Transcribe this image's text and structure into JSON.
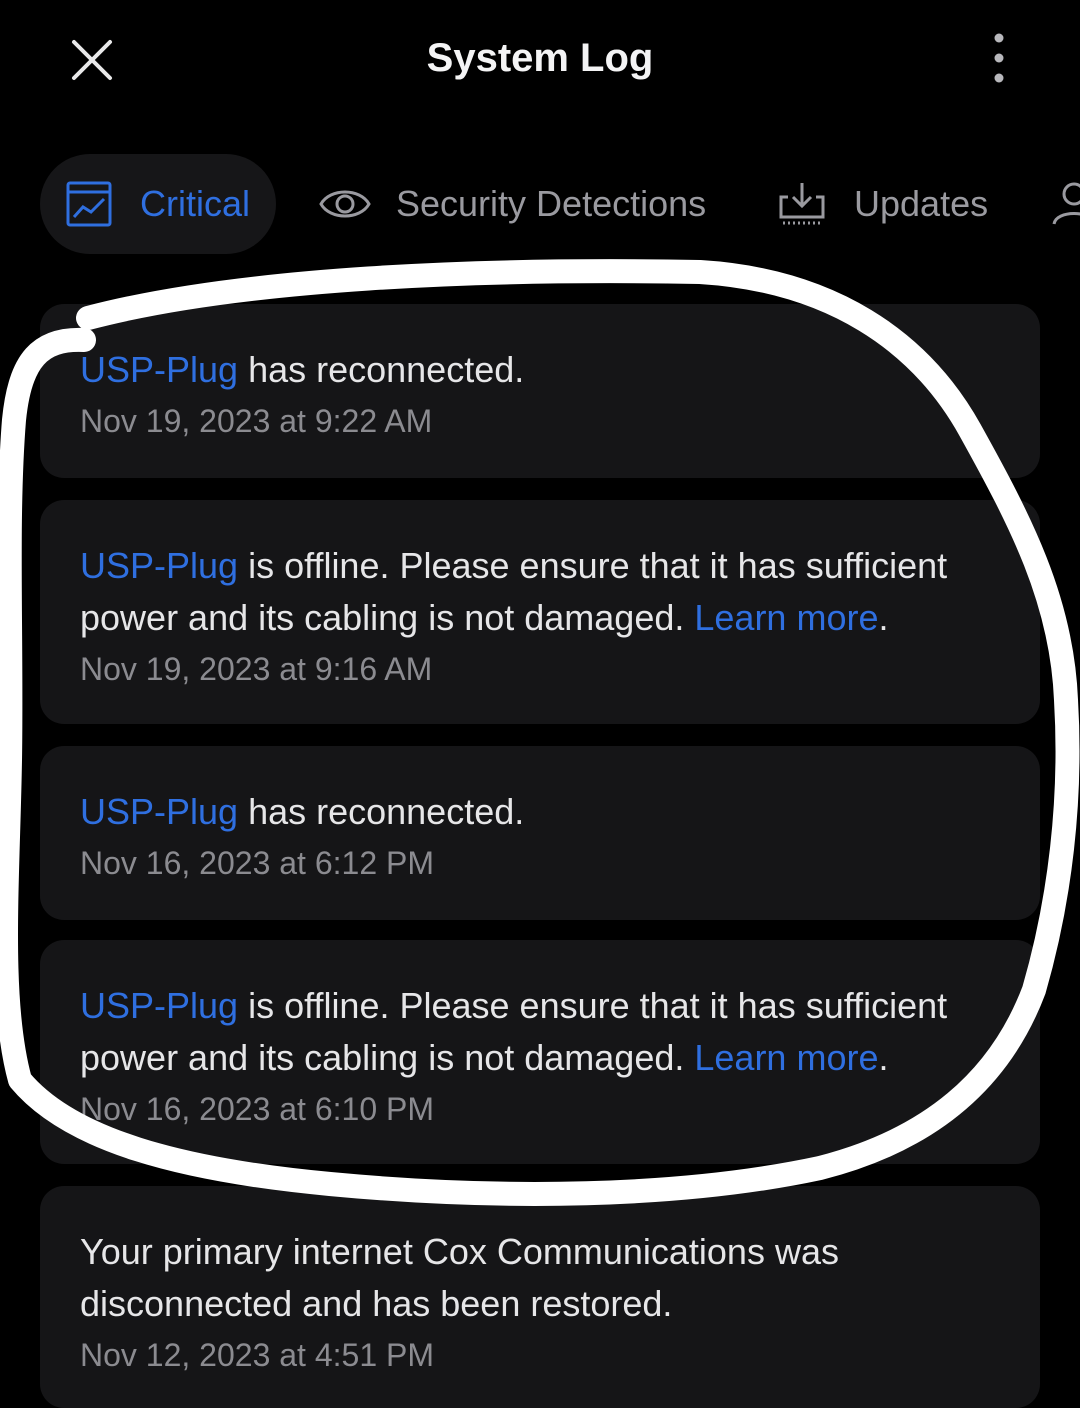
{
  "header": {
    "title": "System Log",
    "close_icon": "close-icon",
    "more_icon": "more-vertical-icon"
  },
  "tabs": [
    {
      "label": "Critical",
      "icon": "chart-window-icon",
      "active": true
    },
    {
      "label": "Security Detections",
      "icon": "eye-icon",
      "active": false
    },
    {
      "label": "Updates",
      "icon": "download-tray-icon",
      "active": false
    },
    {
      "label": "",
      "icon": "user-icon",
      "active": false
    }
  ],
  "logs": [
    {
      "device": "USP-Plug",
      "message": " has reconnected.",
      "link": "",
      "suffix": "",
      "time": "Nov 19, 2023 at 9:22 AM"
    },
    {
      "device": "USP-Plug",
      "message": " is offline. Please ensure that it has sufficient power and its cabling is not damaged. ",
      "link": "Learn more",
      "suffix": ".",
      "time": "Nov 19, 2023 at 9:16 AM"
    },
    {
      "device": "USP-Plug",
      "message": " has reconnected.",
      "link": "",
      "suffix": "",
      "time": "Nov 16, 2023 at 6:12 PM"
    },
    {
      "device": "USP-Plug",
      "message": " is offline. Please ensure that it has sufficient power and its cabling is not damaged. ",
      "link": "Learn more",
      "suffix": ".",
      "time": "Nov 16, 2023 at 6:10 PM"
    },
    {
      "device": "",
      "message": "Your primary internet Cox Communications was disconnected and has been restored.",
      "link": "",
      "suffix": "",
      "time": "Nov 12, 2023 at 4:51 PM"
    }
  ],
  "colors": {
    "accent": "#2f6fe0",
    "background": "#000000",
    "card": "#151517",
    "text": "#e6e6e8",
    "muted": "#8b8b90",
    "annotation": "#ffffff"
  }
}
